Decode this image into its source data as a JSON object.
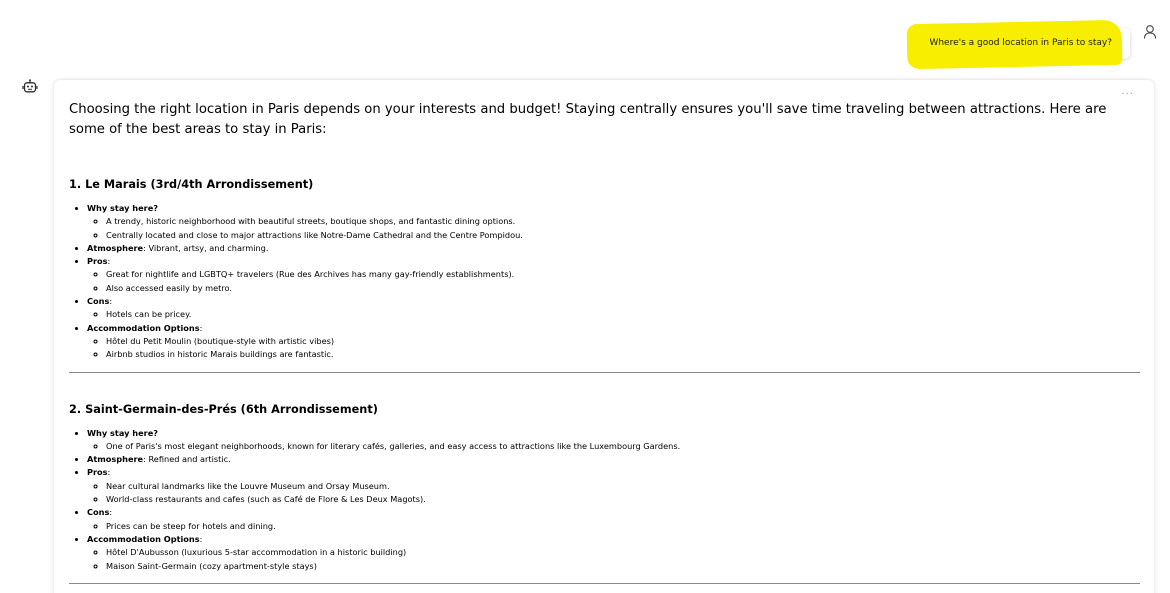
{
  "user_message": {
    "text": "Where's a good location in Paris to stay?",
    "highlight_color": "#f8ee00",
    "avatar_icon": "user-icon"
  },
  "bot": {
    "icon": "bot-icon",
    "more_label": "...",
    "intro": "Choosing the right location in Paris depends on your interests and budget! Staying centrally ensures you'll save time traveling between attractions. Here are some of the best areas to stay in Paris:",
    "sections": [
      {
        "title": "1. Le Marais (3rd/4th Arrondissement)",
        "why_label": "Why stay here?",
        "why": [
          "A trendy, historic neighborhood with beautiful streets, boutique shops, and fantastic dining options.",
          "Centrally located and close to major attractions like Notre-Dame Cathedral and the Centre Pompidou."
        ],
        "atmosphere_label": "Atmosphere",
        "atmosphere": ": Vibrant, artsy, and charming.",
        "pros_label": "Pros",
        "pros": [
          "Great for nightlife and LGBTQ+ travelers (Rue des Archives has many gay-friendly establishments).",
          "Also accessed easily by metro."
        ],
        "cons_label": "Cons",
        "cons": [
          "Hotels can be pricey."
        ],
        "accommodation_label": "Accommodation Options",
        "accommodation": [
          "Hôtel du Petit Moulin (boutique-style with artistic vibes)",
          "Airbnb studios in historic Marais buildings are fantastic."
        ]
      },
      {
        "title": "2. Saint-Germain-des-Prés (6th Arrondissement)",
        "why_label": "Why stay here?",
        "why": [
          "One of Paris's most elegant neighborhoods, known for literary cafés, galleries, and easy access to attractions like the Luxembourg Gardens."
        ],
        "atmosphere_label": "Atmosphere",
        "atmosphere": ": Refined and artistic.",
        "pros_label": "Pros",
        "pros": [
          "Near cultural landmarks like the Louvre Museum and Orsay Museum.",
          "World-class restaurants and cafes (such as Café de Flore & Les Deux Magots)."
        ],
        "cons_label": "Cons",
        "cons": [
          "Prices can be steep for hotels and dining."
        ],
        "accommodation_label": "Accommodation Options",
        "accommodation": [
          "Hôtel D'Aubusson (luxurious 5-star accommodation in a historic building)",
          "Maison Saint-Germain (cozy apartment-style stays)"
        ]
      }
    ]
  }
}
